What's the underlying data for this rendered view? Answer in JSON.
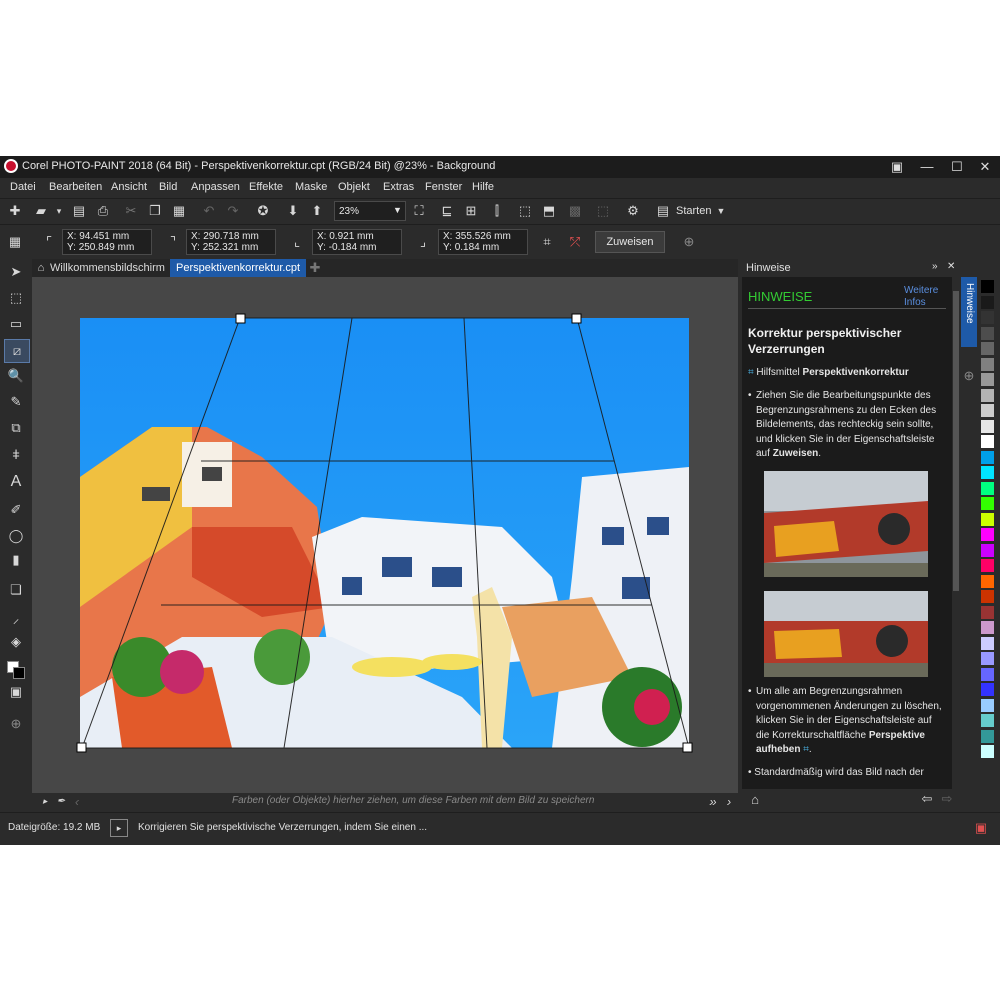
{
  "window": {
    "title": "Corel PHOTO-PAINT 2018 (64 Bit) - Perspektivenkorrektur.cpt (RGB/24 Bit) @23% - Background"
  },
  "menu": [
    "Datei",
    "Bearbeiten",
    "Ansicht",
    "Bild",
    "Anpassen",
    "Effekte",
    "Maske",
    "Objekt",
    "Extras",
    "Fenster",
    "Hilfe"
  ],
  "toolbar": {
    "zoom": "23%",
    "start_label": "Starten"
  },
  "propbar": {
    "p1": {
      "x": "94.451 mm",
      "y": "250.849 mm"
    },
    "p2": {
      "x": "290.718 mm",
      "y": "252.321 mm"
    },
    "p3": {
      "x": "0.921 mm",
      "y": "-0.184 mm"
    },
    "p4": {
      "x": "355.526 mm",
      "y": "0.184 mm"
    },
    "x_label": "X:",
    "y_label": "Y:",
    "apply_label": "Zuweisen"
  },
  "tabs": {
    "welcome": "Willkommensbildschirm",
    "doc": "Perspektivenkorrektur.cpt"
  },
  "palette_hint": "Farben (oder Objekte) hierher ziehen, um diese Farben mit dem Bild zu speichern",
  "hints": {
    "panel_title": "Hinweise",
    "side_tab": "Hinweise",
    "heading": "HINWEISE",
    "more_info": "Weitere Infos",
    "subheading": "Korrektur perspektivischer Verzerrungen",
    "tool_prefix": "Hilfsmittel ",
    "tool_name": "Perspektivenkorrektur",
    "bullet1_a": "Ziehen Sie die Bearbeitungspunkte des Begrenzungsrahmens zu den Ecken des Bildelements, das rechteckig sein sollte, und klicken Sie in der Eigenschaftsleiste auf ",
    "bullet1_b": "Zuweisen",
    "bullet1_c": ".",
    "bullet2_a": "Um alle am Begrenzungsrahmen vorgenommenen Änderungen zu löschen, klicken Sie in der Eigenschaftsleiste auf die Korrekturschaltfläche ",
    "bullet2_b": "Perspektive aufheben",
    "bullet2_c": ".",
    "bullet3": "Standardmäßig wird das Bild nach der"
  },
  "status": {
    "filesize": "Dateigröße: 19.2 MB",
    "message": "Korrigieren Sie perspektivische Verzerrungen, indem Sie einen ..."
  },
  "colors": {
    "accent_green": "#33cc33",
    "tab_active": "#1e5aa8",
    "link_blue": "#5a8ede"
  },
  "palette_colors": [
    "#000000",
    "#1a1a1a",
    "#333333",
    "#4d4d4d",
    "#666666",
    "#808080",
    "#999999",
    "#b3b3b3",
    "#cccccc",
    "#e6e6e6",
    "#ffffff",
    "#00a0e9",
    "#00e5ff",
    "#00ff80",
    "#33ff00",
    "#ccff00",
    "#ff00ff",
    "#cc00ff",
    "#ff0066",
    "#ff6600",
    "#cc3300",
    "#993333",
    "#cc99cc",
    "#ccccff",
    "#9999ff",
    "#6666ff",
    "#3333ff",
    "#99ccff",
    "#66cccc",
    "#339999",
    "#ccffff"
  ]
}
